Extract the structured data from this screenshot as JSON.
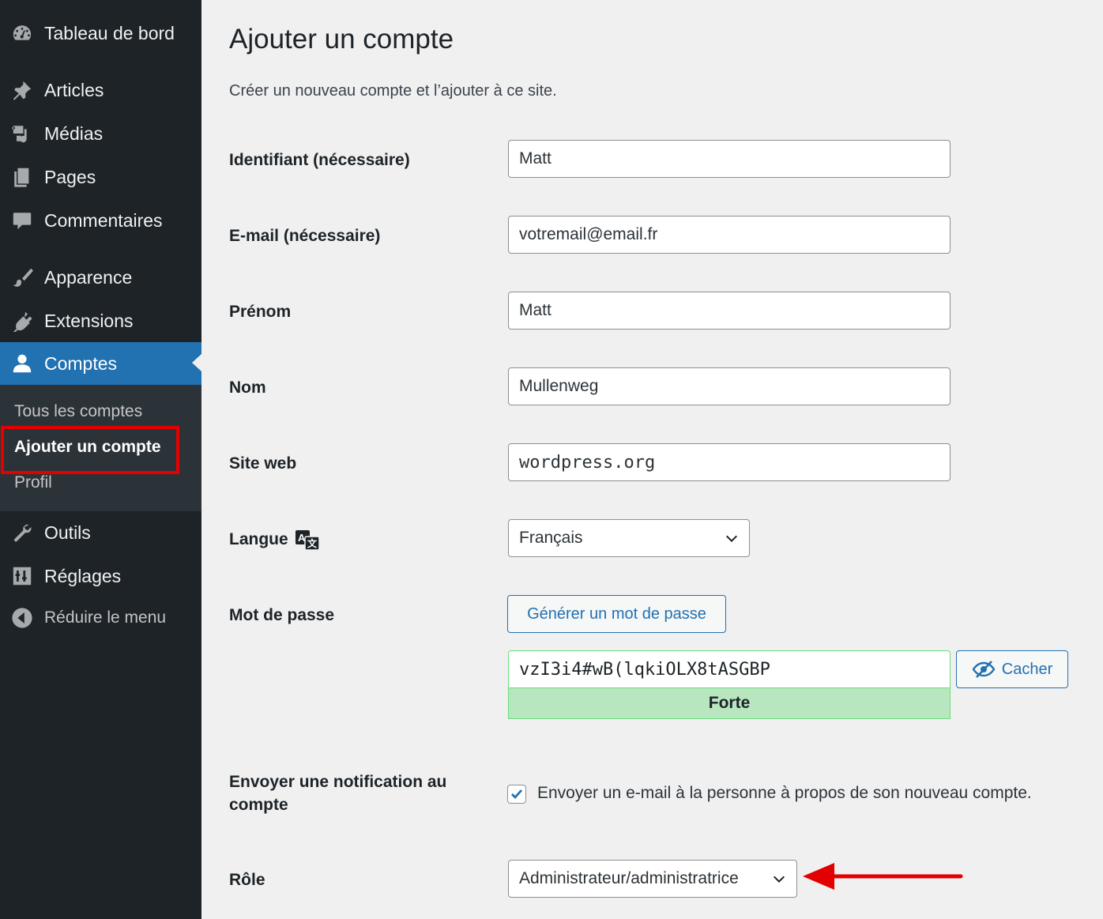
{
  "sidebar": {
    "menu": {
      "dashboard": "Tableau de bord",
      "posts": "Articles",
      "media": "Médias",
      "pages": "Pages",
      "comments": "Commentaires",
      "appearance": "Apparence",
      "plugins": "Extensions",
      "users": "Comptes",
      "tools": "Outils",
      "settings": "Réglages",
      "collapse": "Réduire le menu"
    },
    "submenu": {
      "all_users": "Tous les comptes",
      "add_user": "Ajouter un compte",
      "profile": "Profil"
    },
    "icons": [
      "dashboard-icon",
      "pin-icon",
      "media-icon",
      "pages-icon",
      "comment-icon",
      "paintbrush-icon",
      "plugin-icon",
      "user-icon",
      "wrench-icon",
      "settings-icon",
      "collapse-icon"
    ]
  },
  "main": {
    "title": "Ajouter un compte",
    "description": "Créer un nouveau compte et l’ajouter à ce site.",
    "fields": {
      "username": {
        "label": "Identifiant (nécessaire)",
        "value": "Matt"
      },
      "email": {
        "label": "E-mail (nécessaire)",
        "value": "votremail@email.fr"
      },
      "first_name": {
        "label": "Prénom",
        "value": "Matt"
      },
      "last_name": {
        "label": "Nom",
        "value": "Mullenweg"
      },
      "website": {
        "label": "Site web",
        "value": "wordpress.org"
      },
      "language": {
        "label": "Langue",
        "value": "Français"
      },
      "password": {
        "label": "Mot de passe",
        "generate_button": "Générer un mot de passe",
        "value": "vzI3i4#wB(lqkiOLX8tASGBP",
        "strength": "Forte",
        "hide_button": "Cacher"
      },
      "notification": {
        "label": "Envoyer une notification au compte",
        "checkbox_label": "Envoyer un e-mail à la personne à propos de son nouveau compte.",
        "checked": true
      },
      "role": {
        "label": "Rôle",
        "value": "Administrateur/administratrice"
      }
    }
  },
  "colors": {
    "sidebar_bg": "#1d2327",
    "active": "#2271b1",
    "highlight": "#e30000",
    "strength_bg": "#b8e6bf"
  }
}
